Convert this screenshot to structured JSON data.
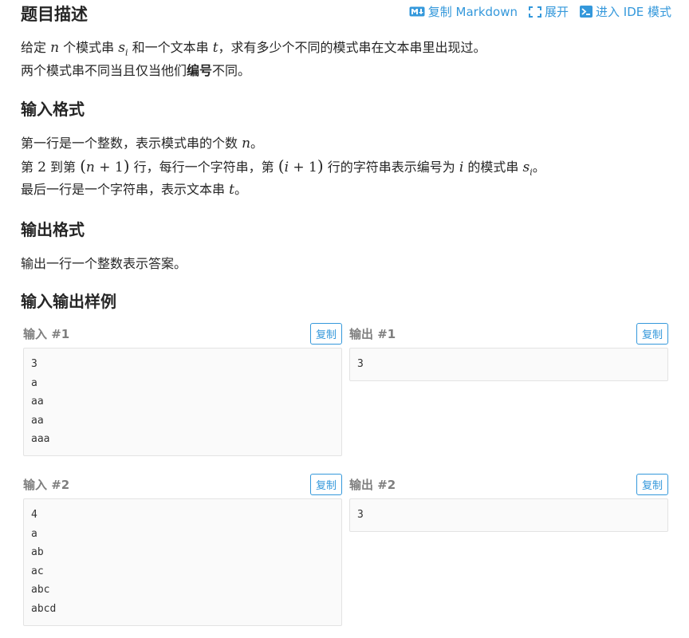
{
  "header": {
    "title": "题目描述",
    "actions": {
      "copy_markdown": "复制 Markdown",
      "expand": "展开",
      "enter_ide": "进入 IDE 模式"
    }
  },
  "description": {
    "line1": {
      "a": "给定 ",
      "n": "n",
      "b": " 个模式串 ",
      "s": "s",
      "sub": "i",
      "c": " 和一个文本串 ",
      "t": "t",
      "d": "，求有多少个不同的模式串在文本串里出现过。"
    },
    "line2": {
      "a": "两个模式串不同当且仅当他们",
      "bold": "编号",
      "b": "不同。"
    }
  },
  "input_format": {
    "title": "输入格式",
    "line1": {
      "a": "第一行是一个整数，表示模式串的个数 ",
      "n": "n",
      "b": "。"
    },
    "line2": {
      "a": "第 ",
      "two": "2",
      "b": " 到第 ",
      "expr1_var": "n",
      "expr1_rest": " + 1",
      "c": " 行，每行一个字符串，第 ",
      "expr2_var": "i",
      "expr2_rest": " + 1",
      "d": " 行的字符串表示编号为 ",
      "i": "i",
      "e": " 的模式串 ",
      "s": "s",
      "sub": "i",
      "f": "。"
    },
    "line3": {
      "a": "最后一行是一个字符串，表示文本串 ",
      "t": "t",
      "b": "。"
    }
  },
  "output_format": {
    "title": "输出格式",
    "line1": "输出一行一个整数表示答案。"
  },
  "samples": {
    "title": "输入输出样例",
    "copy_label": "复制",
    "items": [
      {
        "in_label": "输入 #1",
        "out_label": "输出 #1",
        "input": [
          "3",
          "a",
          "aa",
          "aa",
          "aaa"
        ],
        "output": [
          "3"
        ]
      },
      {
        "in_label": "输入 #2",
        "out_label": "输出 #2",
        "input": [
          "4",
          "a",
          "ab",
          "ac",
          "abc",
          "abcd"
        ],
        "output": [
          "3"
        ]
      }
    ]
  },
  "colors": {
    "accent": "#3498db",
    "text": "#262626",
    "muted": "#7f7f7f",
    "box_bg": "#fafafa",
    "box_border": "#e3e3e3"
  }
}
